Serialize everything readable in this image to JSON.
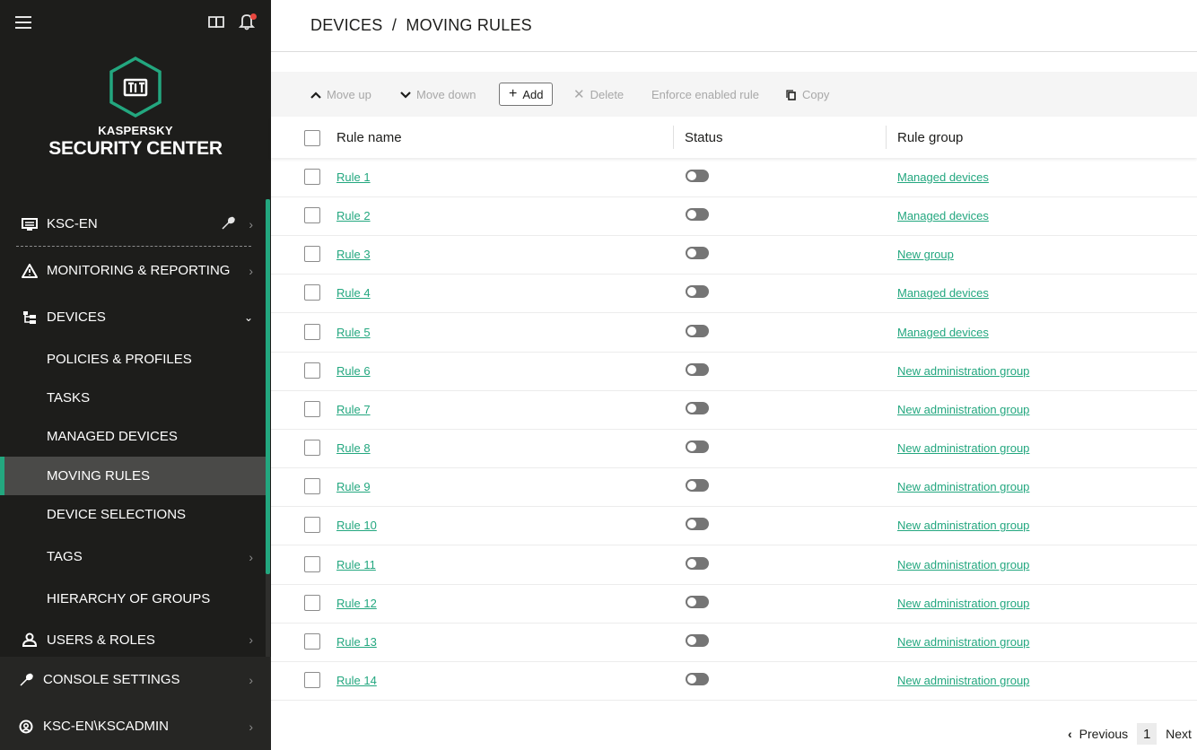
{
  "sidebar": {
    "brand_line1": "KASPERSKY",
    "brand_line2": "SECURITY CENTER",
    "server": {
      "label": "KSC-EN",
      "icon": "server-icon"
    },
    "items": [
      {
        "label": "MONITORING & REPORTING",
        "icon": "warning-icon"
      },
      {
        "label": "DEVICES",
        "icon": "devices-tree-icon"
      },
      {
        "label": "POLICIES & PROFILES"
      },
      {
        "label": "TASKS"
      },
      {
        "label": "MANAGED DEVICES"
      },
      {
        "label": "MOVING RULES"
      },
      {
        "label": "DEVICE SELECTIONS"
      },
      {
        "label": "TAGS"
      },
      {
        "label": "HIERARCHY OF GROUPS"
      },
      {
        "label": "USERS & ROLES",
        "icon": "user-icon"
      }
    ],
    "bottom": [
      {
        "label": "CONSOLE SETTINGS",
        "icon": "wrench-icon"
      },
      {
        "label": "KSC-EN\\KSCADMIN",
        "icon": "account-icon"
      }
    ],
    "active_item": "MOVING RULES",
    "accent_color": "#23a77f"
  },
  "header": {
    "breadcrumb": "DEVICES  /  MOVING RULES"
  },
  "toolbar": {
    "move_up": "Move up",
    "move_down": "Move down",
    "add": "Add",
    "delete": "Delete",
    "enforce": "Enforce enabled rule",
    "copy": "Copy"
  },
  "table": {
    "columns": [
      "Rule name",
      "Status",
      "Rule group"
    ],
    "rows": [
      {
        "name": "Rule 1",
        "group": "Managed devices",
        "enabled": false
      },
      {
        "name": "Rule 2",
        "group": "Managed devices",
        "enabled": false
      },
      {
        "name": "Rule 3",
        "group": "New group",
        "enabled": false
      },
      {
        "name": "Rule 4",
        "group": "Managed devices",
        "enabled": false
      },
      {
        "name": "Rule 5",
        "group": "Managed devices",
        "enabled": false
      },
      {
        "name": "Rule 6",
        "group": "New administration group",
        "enabled": false
      },
      {
        "name": "Rule 7",
        "group": "New administration group",
        "enabled": false
      },
      {
        "name": "Rule 8",
        "group": "New administration group",
        "enabled": false
      },
      {
        "name": "Rule 9",
        "group": "New administration group",
        "enabled": false
      },
      {
        "name": "Rule 10",
        "group": "New administration group",
        "enabled": false
      },
      {
        "name": "Rule 11",
        "group": "New administration group",
        "enabled": false
      },
      {
        "name": "Rule 12",
        "group": "New administration group",
        "enabled": false
      },
      {
        "name": "Rule 13",
        "group": "New administration group",
        "enabled": false
      },
      {
        "name": "Rule 14",
        "group": "New administration group",
        "enabled": false
      }
    ]
  },
  "pager": {
    "previous": "Previous",
    "page": "1",
    "next": "Next"
  }
}
